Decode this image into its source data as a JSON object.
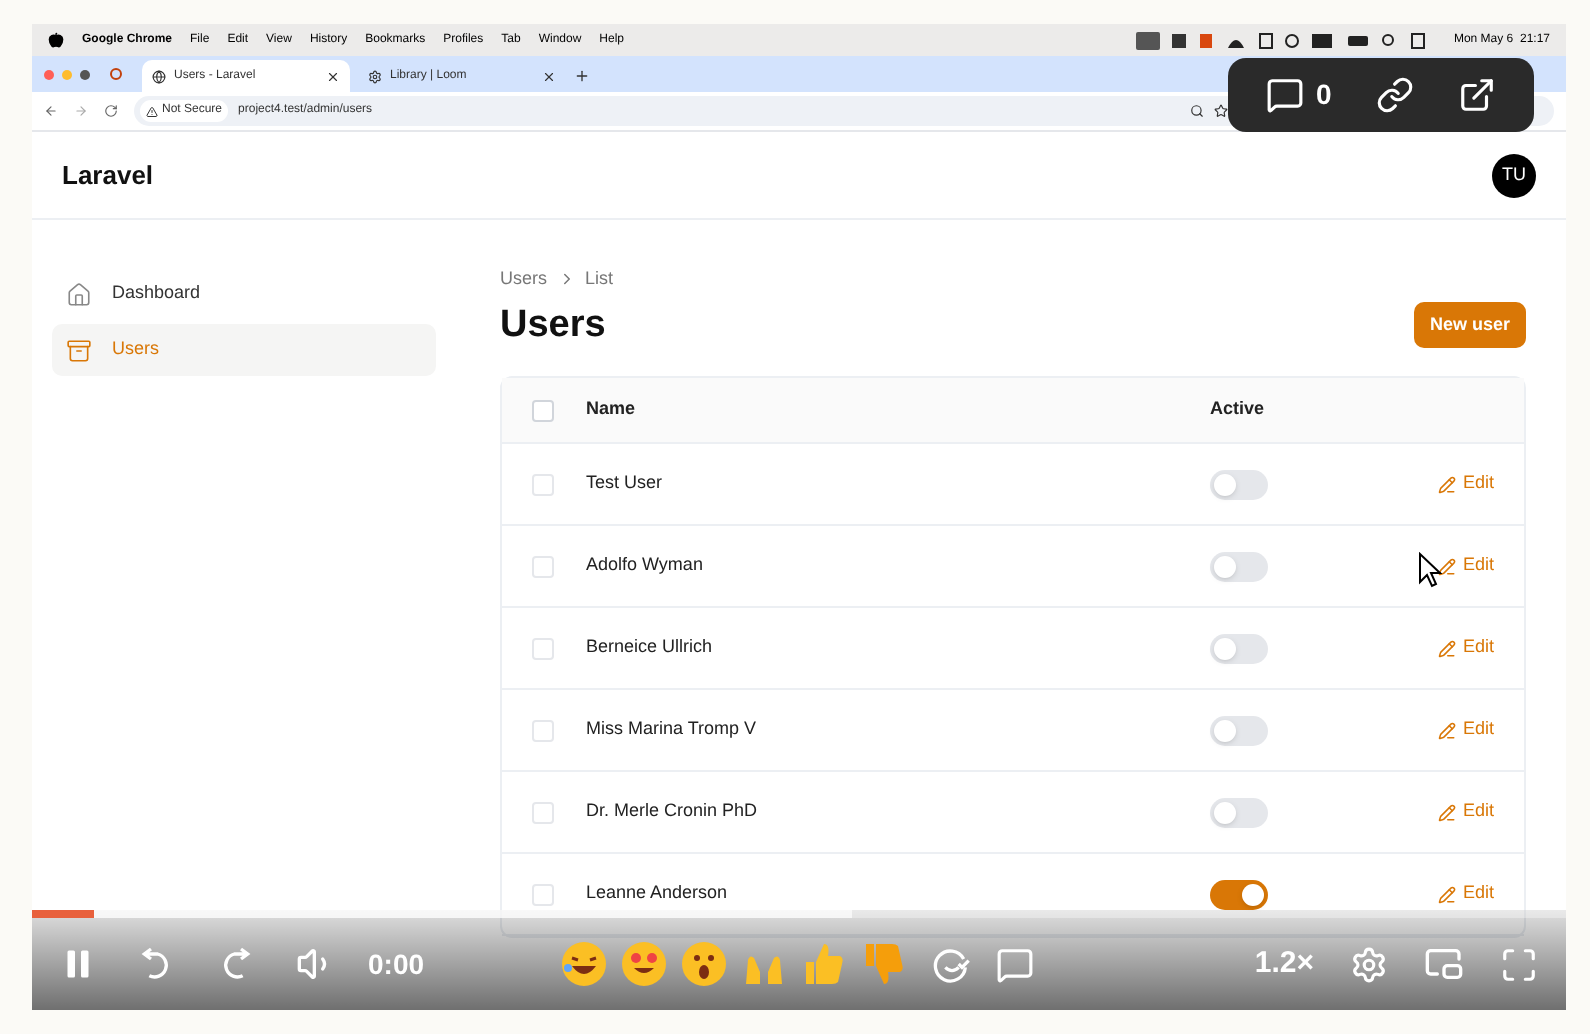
{
  "menu_bar": {
    "app": "Google Chrome",
    "menus": [
      "File",
      "Edit",
      "View",
      "History",
      "Bookmarks",
      "Profiles",
      "Tab",
      "Window",
      "Help"
    ],
    "clock": "Mon May 6  21:17"
  },
  "tabs": [
    {
      "title": "Users - Laravel",
      "selected": true
    },
    {
      "title": "Library | Loom",
      "selected": false
    }
  ],
  "address": {
    "security": "Not Secure",
    "url": "project4.test/admin/users"
  },
  "share_overlay": {
    "comment_count": "0"
  },
  "app": {
    "brand": "Laravel",
    "avatar": "TU"
  },
  "sidebar": [
    {
      "label": "Dashboard",
      "selected": false
    },
    {
      "label": "Users",
      "selected": true
    }
  ],
  "breadcrumb": [
    "Users",
    "List"
  ],
  "title": "Users",
  "new_button": "New user",
  "table": {
    "columns": [
      "Name",
      "Active"
    ],
    "all_checked": false,
    "rows": [
      {
        "checked": false,
        "name": "Test User",
        "active": false,
        "action": "Edit"
      },
      {
        "checked": false,
        "name": "Adolfo Wyman",
        "active": false,
        "action": "Edit"
      },
      {
        "checked": false,
        "name": "Berneice Ullrich",
        "active": false,
        "action": "Edit"
      },
      {
        "checked": false,
        "name": "Miss Marina Tromp V",
        "active": false,
        "action": "Edit"
      },
      {
        "checked": false,
        "name": "Dr. Merle Cronin PhD",
        "active": false,
        "action": "Edit"
      },
      {
        "checked": false,
        "name": "Leanne Anderson",
        "active": true,
        "action": "Edit"
      }
    ]
  },
  "player": {
    "level": 0.04,
    "time": "0:00",
    "speed": "1.2×"
  }
}
